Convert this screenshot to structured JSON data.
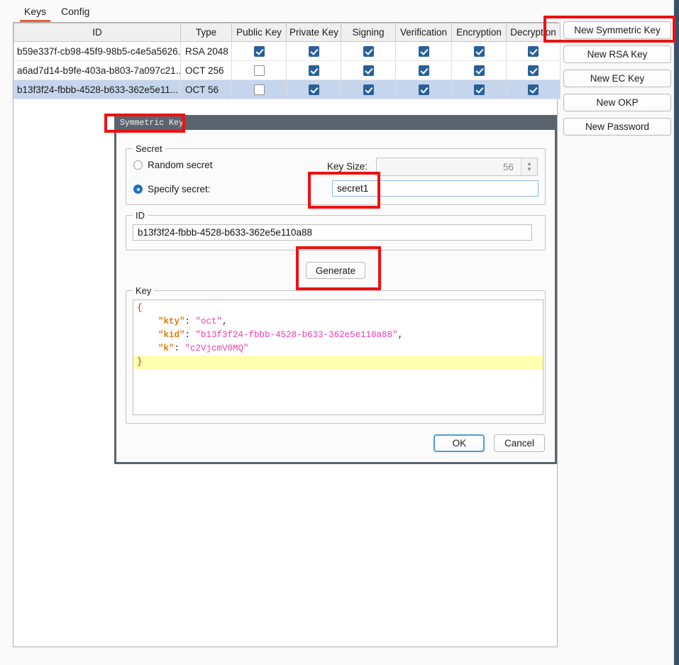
{
  "tabs": [
    {
      "label": "Keys",
      "active": true
    },
    {
      "label": "Config",
      "active": false
    }
  ],
  "table": {
    "headers": [
      "ID",
      "Type",
      "Public Key",
      "Private Key",
      "Signing",
      "Verification",
      "Encryption",
      "Decryption"
    ],
    "rows": [
      {
        "id": "b59e337f-cb98-45f9-98b5-c4e5a5626...",
        "type": "RSA 2048",
        "public_key": true,
        "private_key": true,
        "signing": true,
        "verification": true,
        "encryption": true,
        "decryption": true,
        "selected": false
      },
      {
        "id": "a6ad7d14-b9fe-403a-b803-7a097c21...",
        "type": "OCT 256",
        "public_key": false,
        "private_key": true,
        "signing": true,
        "verification": true,
        "encryption": true,
        "decryption": true,
        "selected": false
      },
      {
        "id": "b13f3f24-fbbb-4528-b633-362e5e11...",
        "type": "OCT 56",
        "public_key": false,
        "private_key": true,
        "signing": true,
        "verification": true,
        "encryption": true,
        "decryption": true,
        "selected": true
      }
    ]
  },
  "side_buttons": [
    {
      "label": "New Symmetric Key",
      "highlighted": true
    },
    {
      "label": "New RSA Key",
      "highlighted": false
    },
    {
      "label": "New EC Key",
      "highlighted": false
    },
    {
      "label": "New OKP",
      "highlighted": false
    },
    {
      "label": "New Password",
      "highlighted": false
    }
  ],
  "dialog": {
    "title": "Symmetric Key",
    "secret": {
      "group_label": "Secret",
      "random_option": "Random secret",
      "random_selected": false,
      "specify_option": "Specify secret:",
      "specify_selected": true,
      "key_size_label": "Key Size:",
      "key_size_value": "56",
      "key_size_disabled": true,
      "secret_value": "secret1",
      "secret_placeholder": ""
    },
    "id": {
      "group_label": "ID",
      "value": "b13f3f24-fbbb-4528-b633-362e5e110a88",
      "placeholder": ""
    },
    "generate_label": "Generate",
    "key": {
      "group_label": "Key",
      "json_lines": [
        {
          "text": "{",
          "highlight": false
        },
        {
          "text": "    \"kty\": \"oct\",",
          "highlight": false
        },
        {
          "text": "    \"kid\": \"b13f3f24-fbbb-4528-b633-362e5e110a88\",",
          "highlight": false
        },
        {
          "text": "    \"k\": \"c2VjcmV0MQ\"",
          "highlight": false
        },
        {
          "text": "}",
          "highlight": true
        }
      ],
      "parsed": {
        "kty": "oct",
        "kid": "b13f3f24-fbbb-4528-b633-362e5e110a88",
        "k": "c2VjcmV0MQ"
      }
    },
    "ok_label": "OK",
    "cancel_label": "Cancel"
  },
  "colors": {
    "tab_accent": "#e8603c",
    "checkbox_checked": "#2a6099",
    "row_selected": "#c5d5ed",
    "annotation": "#ee1111",
    "dialog_titlebar": "#5a646e",
    "json_highlight": "#ffffb0",
    "radio_selected": "#1a72c8"
  },
  "annotations": [
    {
      "name": "new-symmetric-key-highlight"
    },
    {
      "name": "dialog-title-highlight"
    },
    {
      "name": "secret-input-highlight"
    },
    {
      "name": "generate-button-highlight"
    }
  ]
}
